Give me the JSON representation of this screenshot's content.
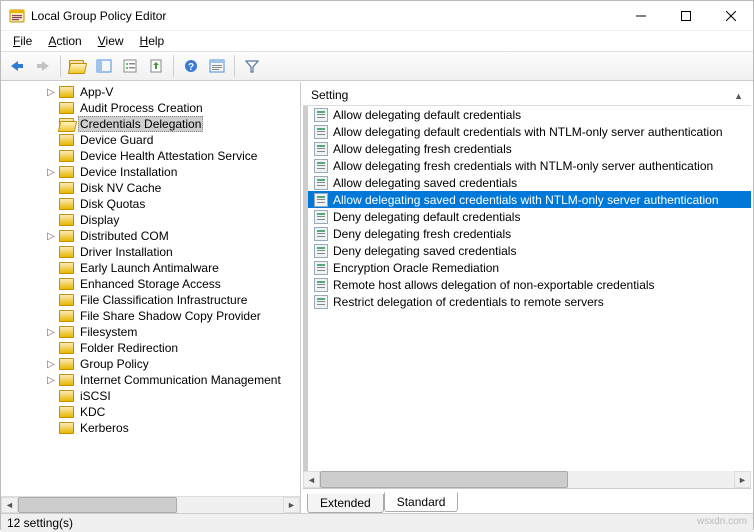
{
  "window": {
    "title": "Local Group Policy Editor",
    "min_tooltip": "Minimize",
    "max_tooltip": "Maximize",
    "close_tooltip": "Close"
  },
  "menu": {
    "file": "File",
    "action": "Action",
    "view": "View",
    "help": "Help"
  },
  "toolbar": {
    "back": "Back",
    "forward": "Forward",
    "up": "Up",
    "show_hide": "Show/Hide Console Tree",
    "properties": "Properties",
    "refresh": "Refresh",
    "export": "Export List",
    "help": "Help",
    "filter_options": "Filter Options",
    "filter": "Filter"
  },
  "tree": {
    "selected_index": 2,
    "items": [
      {
        "label": "App-V",
        "expandable": true
      },
      {
        "label": "Audit Process Creation"
      },
      {
        "label": "Credentials Delegation"
      },
      {
        "label": "Device Guard"
      },
      {
        "label": "Device Health Attestation Service"
      },
      {
        "label": "Device Installation",
        "expandable": true
      },
      {
        "label": "Disk NV Cache"
      },
      {
        "label": "Disk Quotas"
      },
      {
        "label": "Display"
      },
      {
        "label": "Distributed COM",
        "expandable": true
      },
      {
        "label": "Driver Installation"
      },
      {
        "label": "Early Launch Antimalware"
      },
      {
        "label": "Enhanced Storage Access"
      },
      {
        "label": "File Classification Infrastructure"
      },
      {
        "label": "File Share Shadow Copy Provider"
      },
      {
        "label": "Filesystem",
        "expandable": true
      },
      {
        "label": "Folder Redirection"
      },
      {
        "label": "Group Policy",
        "expandable": true
      },
      {
        "label": "Internet Communication Management",
        "expandable": true
      },
      {
        "label": "iSCSI"
      },
      {
        "label": "KDC"
      },
      {
        "label": "Kerberos"
      }
    ]
  },
  "list": {
    "column_header": "Setting",
    "selected_index": 5,
    "items": [
      {
        "label": "Allow delegating default credentials"
      },
      {
        "label": "Allow delegating default credentials with NTLM-only server authentication"
      },
      {
        "label": "Allow delegating fresh credentials"
      },
      {
        "label": "Allow delegating fresh credentials with NTLM-only server authentication"
      },
      {
        "label": "Allow delegating saved credentials"
      },
      {
        "label": "Allow delegating saved credentials with NTLM-only server authentication"
      },
      {
        "label": "Deny delegating default credentials"
      },
      {
        "label": "Deny delegating fresh credentials"
      },
      {
        "label": "Deny delegating saved credentials"
      },
      {
        "label": "Encryption Oracle Remediation"
      },
      {
        "label": "Remote host allows delegation of non-exportable credentials"
      },
      {
        "label": "Restrict delegation of credentials to remote servers"
      }
    ]
  },
  "tabs": {
    "extended": "Extended",
    "standard": "Standard",
    "active": "standard"
  },
  "status": {
    "text": "12 setting(s)"
  },
  "watermark": "wsxdn.com"
}
